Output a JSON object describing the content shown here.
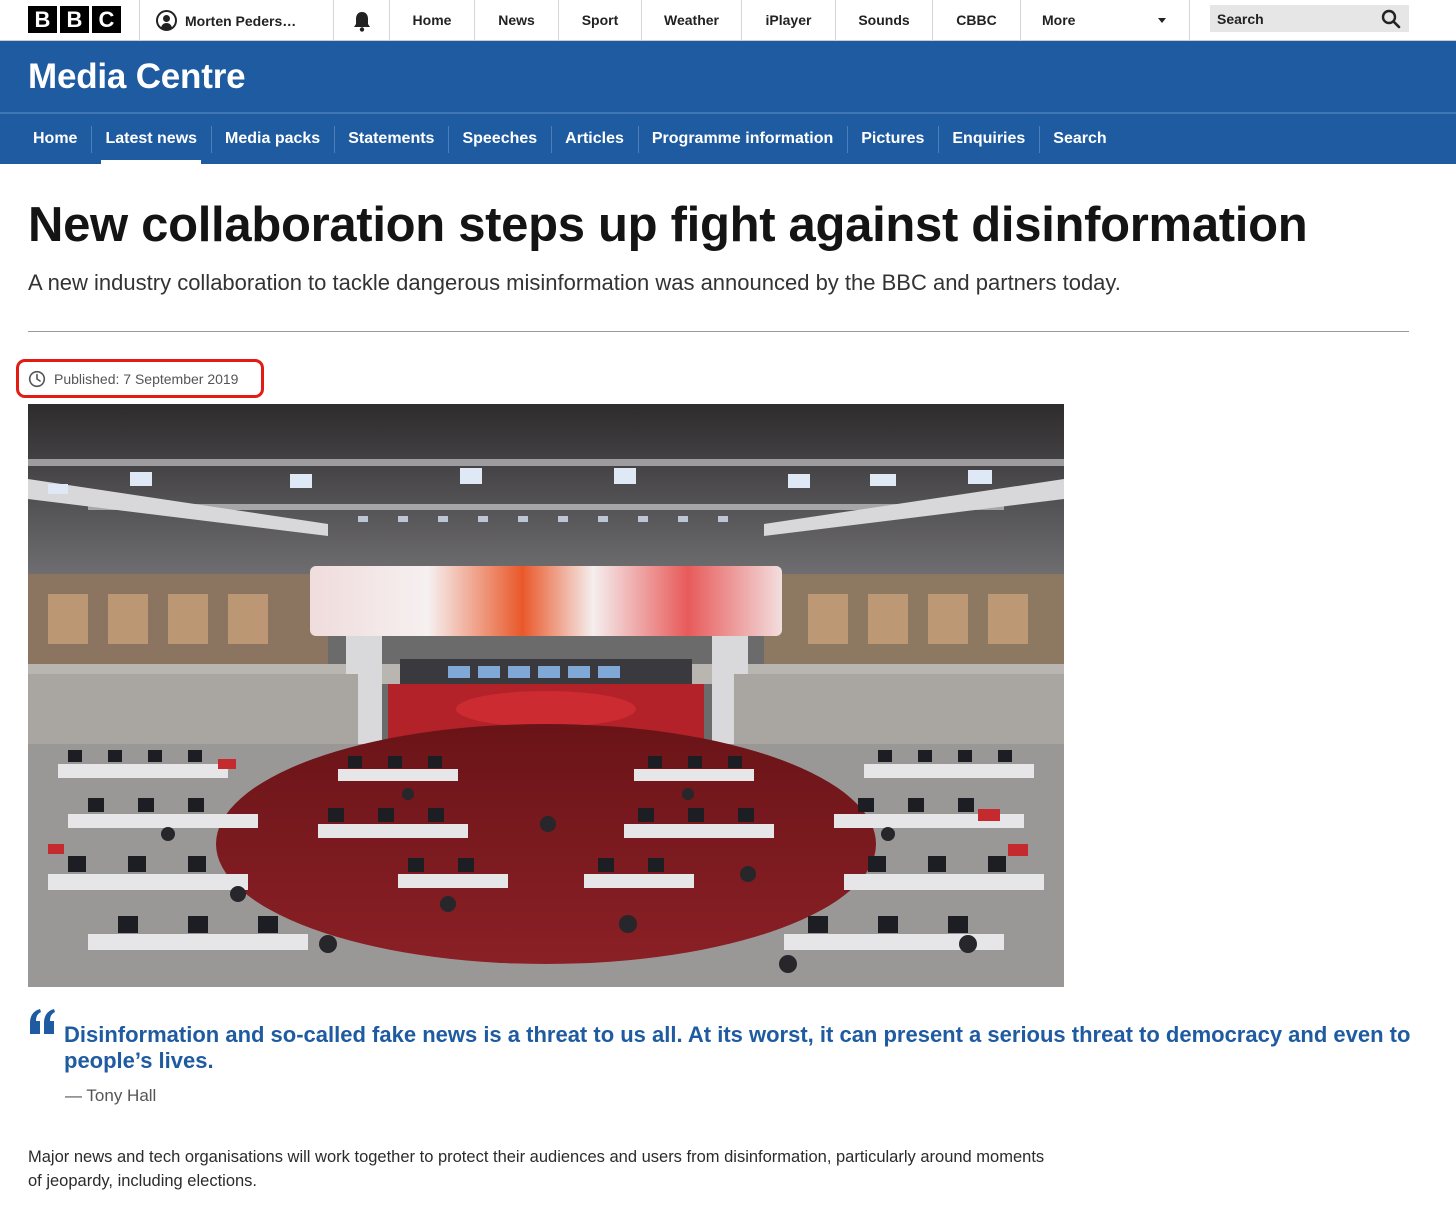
{
  "global_nav": {
    "logo_letters": [
      "B",
      "B",
      "C"
    ],
    "account_name": "Morten Peders…",
    "notifications_icon": "bell-icon",
    "items": [
      "Home",
      "News",
      "Sport",
      "Weather",
      "iPlayer",
      "Sounds",
      "CBBC",
      "More"
    ],
    "search_placeholder": "Search",
    "search_icon": "magnifier-icon"
  },
  "media_centre": {
    "title": "Media Centre",
    "subnav": [
      "Home",
      "Latest news",
      "Media packs",
      "Statements",
      "Speeches",
      "Articles",
      "Programme information",
      "Pictures",
      "Enquiries",
      "Search"
    ],
    "active_item": "Latest news",
    "brand_color": "#1f5ba0"
  },
  "article": {
    "headline": "New collaboration steps up fight against disinformation",
    "standfirst": "A new industry collaboration to tackle dangerous misinformation was announced by the BBC and partners today.",
    "published": "Published: 7 September 2019",
    "published_icon": "clock-icon",
    "highlight_color": "#e41b13",
    "quote": {
      "icon": "quote-mark-icon",
      "text": "Disinformation and so-called fake news is a threat to us all. At its worst, it can present a serious threat to democracy and even to people’s lives.",
      "attribution": "— Tony Hall"
    },
    "body": "Major news and tech organisations will work together to protect their audiences and users from disinformation, particularly around moments of jeopardy, including elections."
  }
}
